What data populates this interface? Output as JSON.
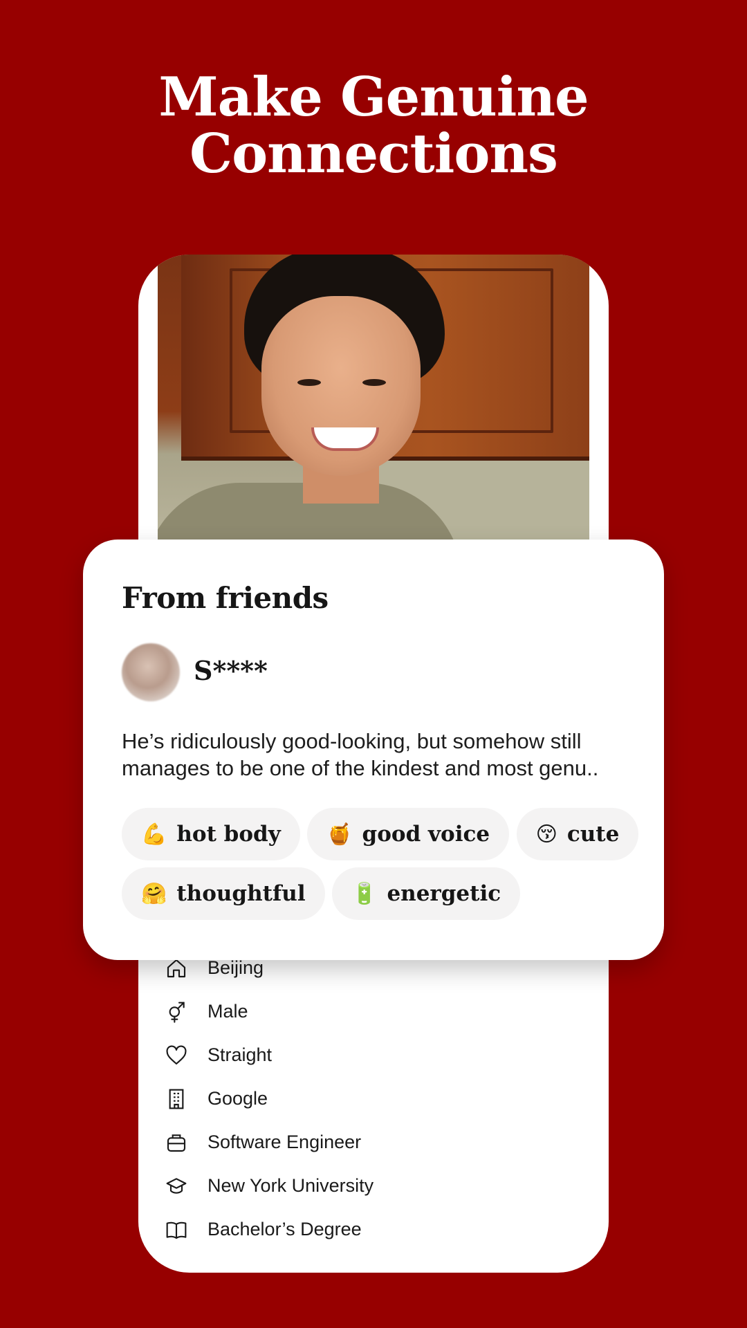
{
  "headline": {
    "line1": "Make Genuine",
    "line2": "Connections"
  },
  "profile_photo": {
    "subject": "smiling young man"
  },
  "card": {
    "title": "From friends",
    "friend_name": "S****",
    "quote": "He’s ridiculously good-looking, but somehow still manages to be one of the kindest and most genu..",
    "tags": [
      {
        "emoji": "💪",
        "label": "hot body"
      },
      {
        "emoji": "🍯",
        "label": "good voice"
      },
      {
        "emoji": "😚",
        "label": "cute"
      },
      {
        "emoji": "🤗",
        "label": "thoughtful"
      },
      {
        "emoji": "🔋",
        "label": "energetic"
      }
    ]
  },
  "info": [
    {
      "icon": "home-icon",
      "label": "Beijing"
    },
    {
      "icon": "gender-icon",
      "label": "Male"
    },
    {
      "icon": "heart-icon",
      "label": "Straight"
    },
    {
      "icon": "building-icon",
      "label": "Google"
    },
    {
      "icon": "briefcase-icon",
      "label": "Software Engineer"
    },
    {
      "icon": "graduation-cap-icon",
      "label": "New York University"
    },
    {
      "icon": "book-icon",
      "label": "Bachelor’s Degree"
    }
  ],
  "colors": {
    "background": "#970000",
    "card": "#ffffff",
    "tag_bg": "#f4f3f3"
  }
}
